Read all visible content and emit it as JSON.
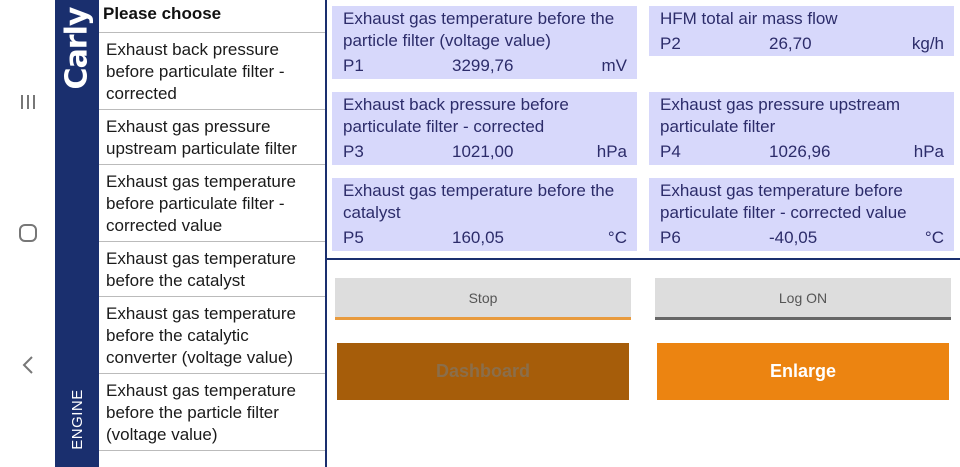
{
  "brand": {
    "logo": "Carly",
    "section": "ENGINE"
  },
  "nav_icons": {
    "recent": "recent-apps-icon",
    "home": "home-icon",
    "back": "back-icon"
  },
  "list": {
    "header": "Please choose",
    "items": [
      "Exhaust back pressure before particulate filter - corrected",
      "Exhaust gas pressure upstream particulate filter",
      "Exhaust gas temperature before particulate filter - corrected value",
      "Exhaust gas temperature before the catalyst",
      "Exhaust gas temperature before the catalytic converter (voltage value)",
      "Exhaust gas temperature before the particle filter (voltage value)"
    ]
  },
  "tiles": [
    {
      "name": "Exhaust gas temperature before the particle filter (voltage value)",
      "id": "P1",
      "value": "3299,76",
      "unit": "mV"
    },
    {
      "name": "HFM total air mass flow",
      "id": "P2",
      "value": "26,70",
      "unit": "kg/h"
    },
    {
      "name": "Exhaust back pressure before particulate filter - corrected",
      "id": "P3",
      "value": "1021,00",
      "unit": "hPa"
    },
    {
      "name": "Exhaust gas pressure upstream particulate filter",
      "id": "P4",
      "value": "1026,96",
      "unit": "hPa"
    },
    {
      "name": "Exhaust gas temperature before the catalyst",
      "id": "P5",
      "value": "160,05",
      "unit": "°C"
    },
    {
      "name": "Exhaust gas temperature before particulate filter - corrected value",
      "id": "P6",
      "value": "-40,05",
      "unit": "°C"
    }
  ],
  "buttons": {
    "stop": "Stop",
    "log": "Log ON",
    "dashboard": "Dashboard",
    "enlarge": "Enlarge"
  },
  "colors": {
    "brand": "#1a2f6e",
    "tile": "#d7d8fb",
    "accent_orange": "#ec8411",
    "dark_orange": "#a65d0a"
  }
}
